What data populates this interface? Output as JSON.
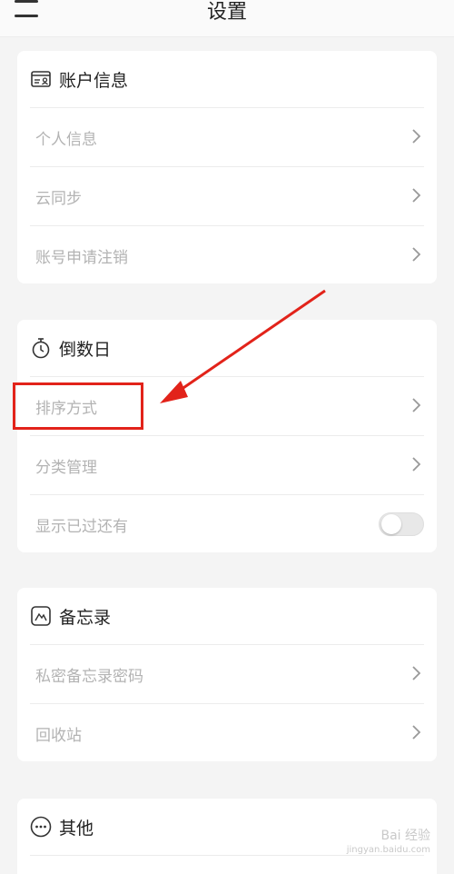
{
  "header": {
    "title": "设置"
  },
  "sections": [
    {
      "title": "账户信息",
      "icon": "id-card-icon",
      "items": [
        {
          "label": "个人信息",
          "control": "chevron"
        },
        {
          "label": "云同步",
          "control": "chevron"
        },
        {
          "label": "账号申请注销",
          "control": "chevron"
        }
      ]
    },
    {
      "title": "倒数日",
      "icon": "stopwatch-icon",
      "items": [
        {
          "label": "排序方式",
          "control": "chevron"
        },
        {
          "label": "分类管理",
          "control": "chevron"
        },
        {
          "label": "显示已过还有",
          "control": "toggle",
          "toggle_on": false
        }
      ]
    },
    {
      "title": "备忘录",
      "icon": "memo-icon",
      "items": [
        {
          "label": "私密备忘录密码",
          "control": "chevron"
        },
        {
          "label": "回收站",
          "control": "chevron"
        }
      ]
    },
    {
      "title": "其他",
      "icon": "more-icon",
      "items": []
    }
  ],
  "annotation": {
    "color": "#e2231a"
  },
  "watermark": {
    "text": "Bai 经验",
    "sub": "jingyan.baidu.com"
  }
}
